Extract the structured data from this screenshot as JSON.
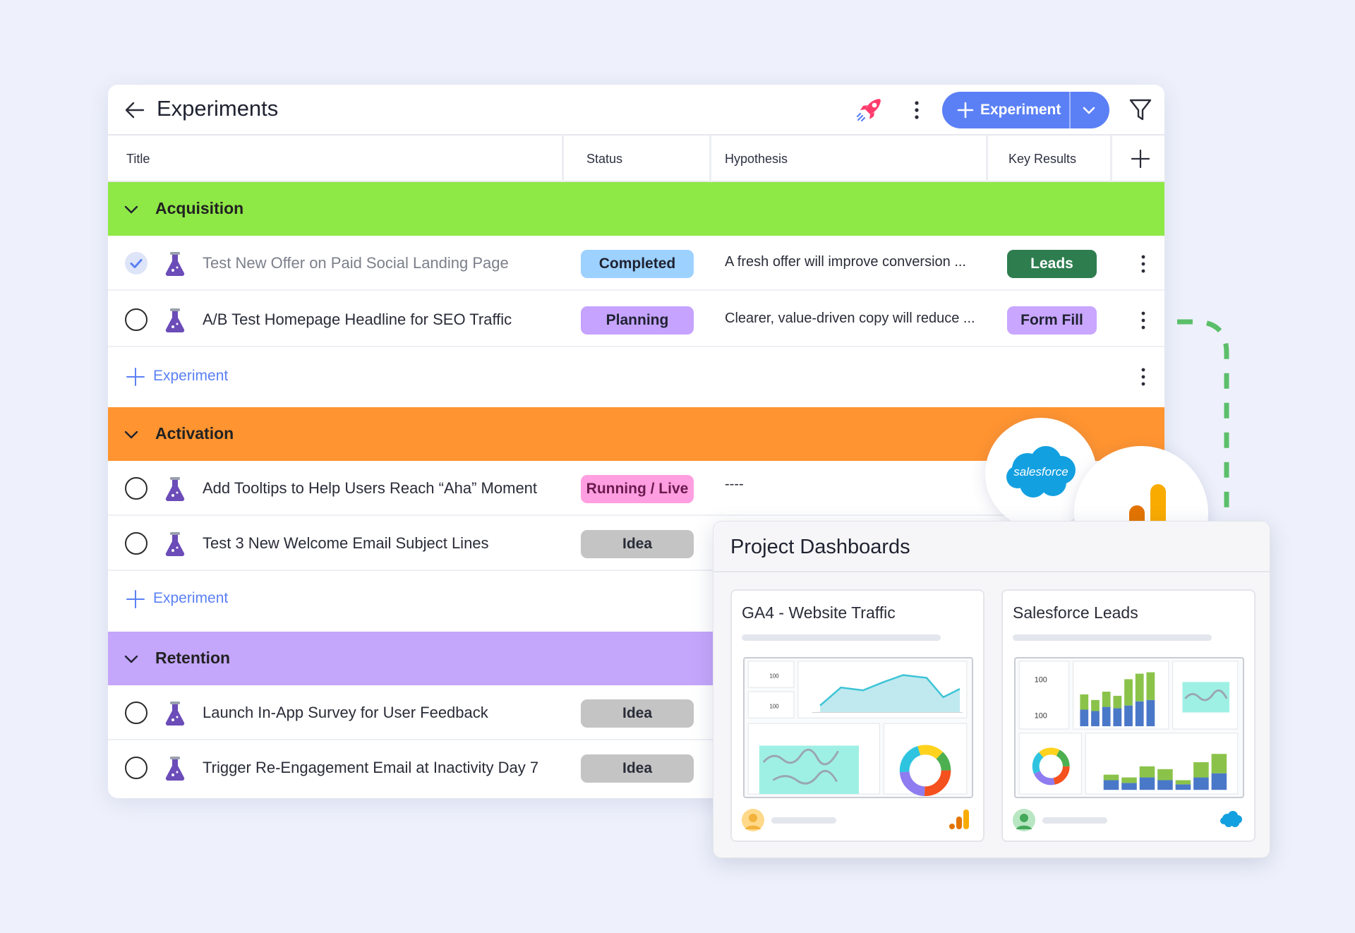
{
  "header": {
    "title": "Experiments",
    "add_button_label": "Experiment"
  },
  "columns": [
    "Title",
    "Status",
    "Hypothesis",
    "Key Results"
  ],
  "groups": [
    {
      "name": "Acquisition",
      "color": "#8ee846",
      "rows": [
        {
          "title": "Test New Offer on Paid Social Landing Page",
          "completed": true,
          "status": "Completed",
          "status_color": "#9dd1ff",
          "hypothesis": "A fresh offer will improve conversion ...",
          "key_result": "Leads",
          "kr_color": "#2e7d4f"
        },
        {
          "title": "A/B Test Homepage Headline for SEO Traffic",
          "completed": false,
          "status": "Planning",
          "status_color": "#c5a3ff",
          "hypothesis": "Clearer, value-driven copy will reduce ...",
          "key_result": "Form Fill",
          "kr_color": "#c9a6ff"
        }
      ],
      "add_label": "Experiment"
    },
    {
      "name": "Activation",
      "color": "#ff9430",
      "rows": [
        {
          "title": "Add Tooltips to Help Users Reach “Aha” Moment",
          "completed": false,
          "status": "Running / Live",
          "status_color": "#ff9ee0",
          "hypothesis": "----"
        },
        {
          "title": "Test 3 New Welcome Email Subject Lines",
          "completed": false,
          "status": "Idea",
          "status_color": "#c4c4c4"
        }
      ],
      "add_label": "Experiment"
    },
    {
      "name": "Retention",
      "color": "#c4a6fb",
      "rows": [
        {
          "title": "Launch In-App Survey for User Feedback",
          "completed": false,
          "status": "Idea",
          "status_color": "#c4c4c4"
        },
        {
          "title": "Trigger Re-Engagement Email at Inactivity Day 7",
          "completed": false,
          "status": "Idea",
          "status_color": "#c4c4c4"
        }
      ]
    }
  ],
  "integrations": {
    "salesforce_logo_text": "salesforce"
  },
  "dashboards": {
    "title": "Project Dashboards",
    "cards": [
      {
        "title": "GA4 - Website Traffic",
        "metric_1": "100",
        "metric_2": "100"
      },
      {
        "title": "Salesforce Leads",
        "metric_1": "100",
        "metric_2": "100"
      }
    ]
  },
  "colors": {
    "accent": "#5b80f5",
    "flask": "#6b4cb8",
    "connector": "#5bbf6a"
  }
}
